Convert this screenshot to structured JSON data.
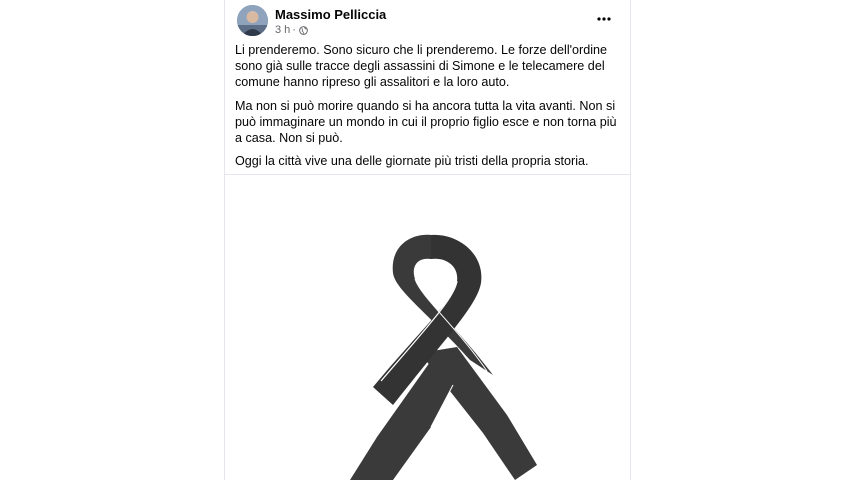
{
  "post": {
    "author": "Massimo Pelliccia",
    "time": "3 h",
    "separator": "·",
    "privacy_icon": "globe-icon",
    "more_icon": "more-options-icon",
    "paragraphs": [
      "Li prenderemo. Sono sicuro che li prenderemo. Le forze dell'ordine sono già sulle tracce degli assassini di Simone e le telecamere del comune hanno ripreso gli assalitori e la loro auto.",
      "Ma non si può morire quando si ha ancora tutta la vita avanti. Non si può immaginare un mondo in cui il proprio figlio esce e non torna più a casa.  Non si può.",
      "Oggi la città vive una delle giornate più tristi della propria storia."
    ],
    "image": {
      "subject": "black-mourning-ribbon",
      "ribbon_color": "#3a3a3a",
      "background": "#ffffff"
    }
  },
  "colors": {
    "text": "#050505",
    "secondary": "#65676b",
    "divider": "#e4e6eb"
  }
}
